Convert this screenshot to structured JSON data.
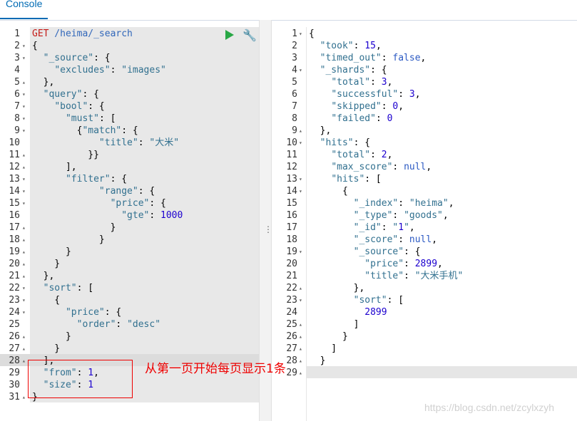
{
  "tab": {
    "label": "Console"
  },
  "request": {
    "method": "GET",
    "url": "/heima/_search",
    "lines": [
      {
        "n": "1",
        "f": "",
        "t": ""
      },
      {
        "n": "2",
        "f": "▾",
        "t": "{"
      },
      {
        "n": "3",
        "f": "▾",
        "t": "  \"_source\": {"
      },
      {
        "n": "4",
        "f": "",
        "t": "    \"excludes\": \"images\""
      },
      {
        "n": "5",
        "f": "▴",
        "t": "  },"
      },
      {
        "n": "6",
        "f": "▾",
        "t": "  \"query\": {"
      },
      {
        "n": "7",
        "f": "▾",
        "t": "    \"bool\": {"
      },
      {
        "n": "8",
        "f": "▾",
        "t": "      \"must\": ["
      },
      {
        "n": "9",
        "f": "▾",
        "t": "        {\"match\": {"
      },
      {
        "n": "10",
        "f": "",
        "t": "            \"title\": \"大米\""
      },
      {
        "n": "11",
        "f": "▴",
        "t": "          }}"
      },
      {
        "n": "12",
        "f": "▴",
        "t": "      ],"
      },
      {
        "n": "13",
        "f": "▾",
        "t": "      \"filter\": {"
      },
      {
        "n": "14",
        "f": "▾",
        "t": "            \"range\": {"
      },
      {
        "n": "15",
        "f": "▾",
        "t": "              \"price\": {"
      },
      {
        "n": "16",
        "f": "",
        "t": "                \"gte\": 1000"
      },
      {
        "n": "17",
        "f": "▴",
        "t": "              }"
      },
      {
        "n": "18",
        "f": "▴",
        "t": "            }"
      },
      {
        "n": "19",
        "f": "▴",
        "t": "      }"
      },
      {
        "n": "20",
        "f": "▴",
        "t": "    }"
      },
      {
        "n": "21",
        "f": "▴",
        "t": "  },"
      },
      {
        "n": "22",
        "f": "▾",
        "t": "  \"sort\": ["
      },
      {
        "n": "23",
        "f": "▾",
        "t": "    {"
      },
      {
        "n": "24",
        "f": "▾",
        "t": "      \"price\": {"
      },
      {
        "n": "25",
        "f": "",
        "t": "        \"order\": \"desc\""
      },
      {
        "n": "26",
        "f": "▴",
        "t": "      }"
      },
      {
        "n": "27",
        "f": "▴",
        "t": "    }"
      },
      {
        "n": "28",
        "f": "▴",
        "t": "  ],"
      },
      {
        "n": "29",
        "f": "",
        "t": "  \"from\": 1,"
      },
      {
        "n": "30",
        "f": "",
        "t": "  \"size\": 1"
      },
      {
        "n": "31",
        "f": "▴",
        "t": "}"
      }
    ]
  },
  "response": {
    "lines": [
      {
        "n": "1",
        "f": "▾",
        "t": "{"
      },
      {
        "n": "2",
        "f": "",
        "t": "  \"took\": 15,"
      },
      {
        "n": "3",
        "f": "",
        "t": "  \"timed_out\": false,"
      },
      {
        "n": "4",
        "f": "▾",
        "t": "  \"_shards\": {"
      },
      {
        "n": "5",
        "f": "",
        "t": "    \"total\": 3,"
      },
      {
        "n": "6",
        "f": "",
        "t": "    \"successful\": 3,"
      },
      {
        "n": "7",
        "f": "",
        "t": "    \"skipped\": 0,"
      },
      {
        "n": "8",
        "f": "",
        "t": "    \"failed\": 0"
      },
      {
        "n": "9",
        "f": "▴",
        "t": "  },"
      },
      {
        "n": "10",
        "f": "▾",
        "t": "  \"hits\": {"
      },
      {
        "n": "11",
        "f": "",
        "t": "    \"total\": 2,"
      },
      {
        "n": "12",
        "f": "",
        "t": "    \"max_score\": null,"
      },
      {
        "n": "13",
        "f": "▾",
        "t": "    \"hits\": ["
      },
      {
        "n": "14",
        "f": "▾",
        "t": "      {"
      },
      {
        "n": "15",
        "f": "",
        "t": "        \"_index\": \"heima\","
      },
      {
        "n": "16",
        "f": "",
        "t": "        \"_type\": \"goods\","
      },
      {
        "n": "17",
        "f": "",
        "t": "        \"_id\": \"1\","
      },
      {
        "n": "18",
        "f": "",
        "t": "        \"_score\": null,"
      },
      {
        "n": "19",
        "f": "▾",
        "t": "        \"_source\": {"
      },
      {
        "n": "20",
        "f": "",
        "t": "          \"price\": 2899,"
      },
      {
        "n": "21",
        "f": "",
        "t": "          \"title\": \"大米手机\""
      },
      {
        "n": "22",
        "f": "▴",
        "t": "        },"
      },
      {
        "n": "23",
        "f": "▾",
        "t": "        \"sort\": ["
      },
      {
        "n": "24",
        "f": "",
        "t": "          2899"
      },
      {
        "n": "25",
        "f": "▴",
        "t": "        ]"
      },
      {
        "n": "26",
        "f": "▴",
        "t": "      }"
      },
      {
        "n": "27",
        "f": "▴",
        "t": "    ]"
      },
      {
        "n": "28",
        "f": "▴",
        "t": "  }"
      },
      {
        "n": "29",
        "f": "▴",
        "t": "}"
      }
    ]
  },
  "annotation": "从第一页开始每页显示1条",
  "watermark": "https://blog.csdn.net/zcylxzyh",
  "colors": {
    "accent": "#006bb4",
    "run": "#28a745",
    "annotation": "#ee0000"
  }
}
